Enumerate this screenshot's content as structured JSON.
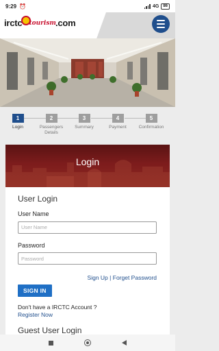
{
  "status_bar": {
    "time": "9:29",
    "network": "4G",
    "battery": "86"
  },
  "header": {
    "logo_left": "irctc",
    "logo_script": "tourism",
    "logo_right": ".com",
    "menu_icon": "hamburger-icon"
  },
  "stepper": {
    "steps": [
      {
        "number": "1",
        "label": "Login",
        "active": true
      },
      {
        "number": "2",
        "label": "Passengers Details",
        "active": false
      },
      {
        "number": "3",
        "label": "Summary",
        "active": false
      },
      {
        "number": "4",
        "label": "Payment",
        "active": false
      },
      {
        "number": "5",
        "label": "Confirmation",
        "active": false
      }
    ]
  },
  "login": {
    "banner_title": "Login",
    "section_title": "User Login",
    "username_label": "User Name",
    "username_placeholder": "User Name",
    "password_label": "Password",
    "password_placeholder": "Password",
    "signup_link": "Sign Up",
    "separator": "|",
    "forgot_link": "Forget Password",
    "signin_button": "SIGN IN",
    "no_account_text": "Don't have a IRCTC Account ?",
    "register_link": "Register Now",
    "guest_title": "Guest User Login"
  },
  "colors": {
    "brand_blue": "#1f4e8c",
    "button_blue": "#1f6fc5",
    "banner_red": "#7d1c1c"
  }
}
